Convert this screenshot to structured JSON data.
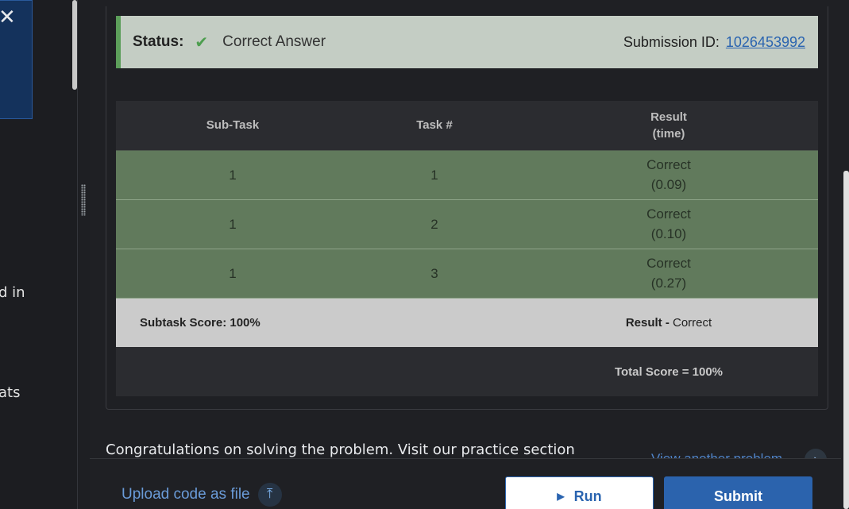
{
  "left_pane": {
    "close_icon": "close-icon",
    "text_fragments": [
      "d in",
      "ats"
    ]
  },
  "status": {
    "label": "Status:",
    "check_icon": "check-icon",
    "value": "Correct Answer",
    "submission_label": "Submission ID:",
    "submission_id": "1026453992"
  },
  "results_table": {
    "headers": [
      "Sub-Task",
      "Task #",
      "Result\n(time)"
    ],
    "header_result_line1": "Result",
    "header_result_line2": "(time)",
    "rows": [
      {
        "subtask": "1",
        "task": "1",
        "result": "Correct",
        "time": "(0.09)"
      },
      {
        "subtask": "1",
        "task": "2",
        "result": "Correct",
        "time": "(0.10)"
      },
      {
        "subtask": "1",
        "task": "3",
        "result": "Correct",
        "time": "(0.27)"
      }
    ],
    "subtask_score": "Subtask Score: 100%",
    "result_label": "Result -",
    "result_value": "Correct",
    "total_score": "Total Score = 100%"
  },
  "congrats_text": "Congratulations on solving the problem. Visit our practice section",
  "view_another": "View another problem",
  "footer": {
    "upload_label": "Upload code as file",
    "upload_icon": "upload-icon",
    "run_label": "Run",
    "submit_label": "Submit"
  },
  "colors": {
    "correct_row": "#617a5c",
    "status_bar": "#c4cdc4",
    "status_accent": "#5c9e5a",
    "primary": "#2b63ad"
  }
}
